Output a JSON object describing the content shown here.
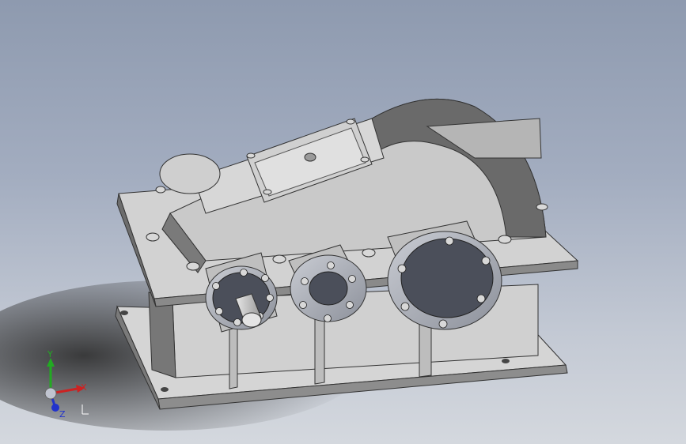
{
  "viewport": {
    "colors": {
      "background_top": "#8e9aaf",
      "background_bottom": "#d4d8de",
      "housing": "#c8c8c8",
      "housing_shadow": "#555555",
      "cap_face": "#4b4f5a",
      "cap_rim": "#b9bdc6",
      "bolt": "#d8d8d8"
    },
    "model": {
      "name": "gear-reducer-assembly"
    }
  },
  "triad": {
    "x_label": "X",
    "y_label": "Y",
    "z_label": "Z",
    "colors": {
      "x": "#cc2222",
      "y": "#22aa22",
      "z": "#2233cc"
    }
  }
}
